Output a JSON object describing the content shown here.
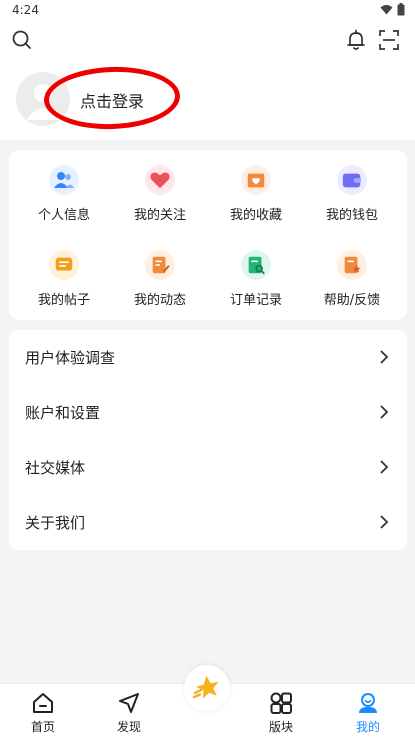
{
  "status_bar": {
    "time": "4:24"
  },
  "header": {
    "login_text": "点击登录"
  },
  "grid": [
    {
      "label": "个人信息",
      "icon": "user-group-icon",
      "color": "#3b82f6"
    },
    {
      "label": "我的关注",
      "icon": "heart-icon",
      "color": "#f0505a"
    },
    {
      "label": "我的收藏",
      "icon": "favorite-box-icon",
      "color": "#f08a3c"
    },
    {
      "label": "我的钱包",
      "icon": "wallet-icon",
      "color": "#6f6ef5"
    },
    {
      "label": "我的帖子",
      "icon": "posts-icon",
      "color": "#f59e1b"
    },
    {
      "label": "我的动态",
      "icon": "edit-note-icon",
      "color": "#f08a3c"
    },
    {
      "label": "订单记录",
      "icon": "order-search-icon",
      "color": "#22b573"
    },
    {
      "label": "帮助/反馈",
      "icon": "help-star-icon",
      "color": "#f08a3c"
    }
  ],
  "menu": [
    {
      "label": "用户体验调查"
    },
    {
      "label": "账户和设置"
    },
    {
      "label": "社交媒体"
    },
    {
      "label": "关于我们"
    }
  ],
  "nav": {
    "home": "首页",
    "discover": "发现",
    "sections": "版块",
    "mine": "我的",
    "active_color": "#1a8cff"
  }
}
